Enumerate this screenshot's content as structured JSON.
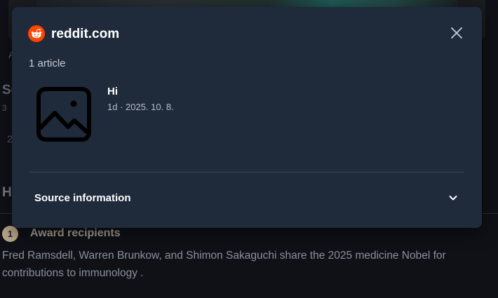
{
  "background": {
    "fragments": [
      "A",
      "Sc",
      "3",
      "2"
    ],
    "section_heading_initial": "H",
    "step_number": "1",
    "award_title": "Award recipients",
    "body_text": "Fred Ramsdell, Warren Brunkow, and Shimon Sakaguchi share the 2025 medicine Nobel for contributions to immunology ."
  },
  "modal": {
    "source_name": "reddit.com",
    "article_count": "1 article",
    "articles": [
      {
        "title": "Hi",
        "meta": "1d · 2025. 10. 8."
      }
    ],
    "source_info_label": "Source information"
  },
  "icons": {
    "brand": "reddit-logo-icon",
    "close": "close-icon",
    "thumbnail": "image-placeholder-icon",
    "expand": "chevron-down-icon"
  },
  "colors": {
    "modal_bg": "#1f2a3b",
    "page_bg": "#0f1117",
    "reddit_orange": "#ff4500"
  }
}
